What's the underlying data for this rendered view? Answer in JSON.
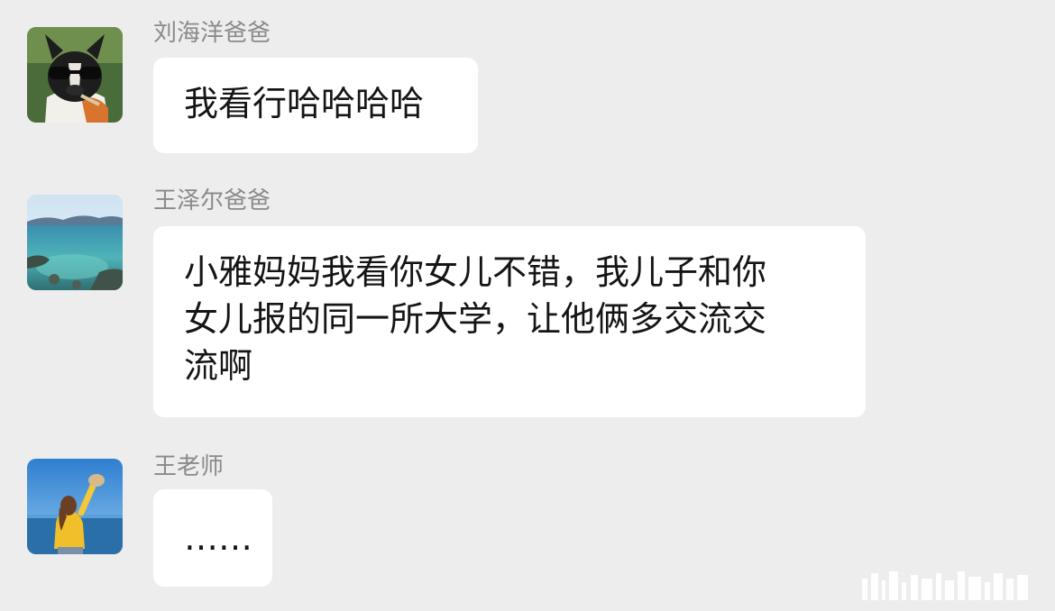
{
  "messages": [
    {
      "sender": "刘海洋爸爸",
      "avatar_icon": "dog-with-sunglasses-avatar-icon",
      "text": "我看行哈哈哈哈"
    },
    {
      "sender": "王泽尔爸爸",
      "avatar_icon": "lake-landscape-avatar-icon",
      "text": "小雅妈妈我看你女儿不错，我儿子和你\n女儿报的同一所大学，让他俩多交流交\n流啊"
    },
    {
      "sender": "王老师",
      "avatar_icon": "woman-at-beach-avatar-icon",
      "text": "……"
    }
  ],
  "colors": {
    "background": "#ededed",
    "bubble": "#ffffff",
    "sender_name": "#8a8a8a",
    "message_text": "#151515"
  }
}
